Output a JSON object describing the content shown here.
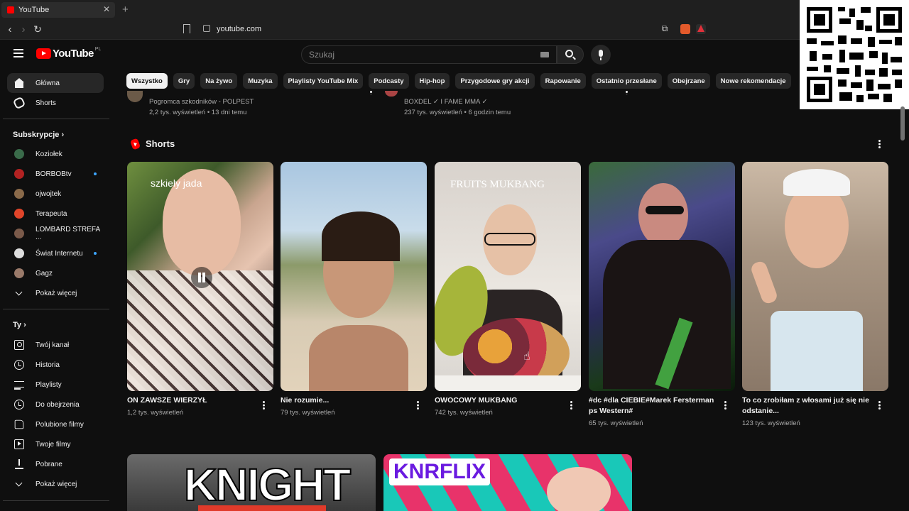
{
  "browser": {
    "tab_title": "YouTube",
    "url": "youtube.com"
  },
  "header": {
    "logo_text": "YouTube",
    "region": "PL",
    "search_placeholder": "Szukaj"
  },
  "sidebar": {
    "main": [
      {
        "label": "Główna",
        "icon": "home-icon",
        "active": true
      },
      {
        "label": "Shorts",
        "icon": "shorts-icon"
      }
    ],
    "subs_title": "Subskrypcje",
    "subs": [
      {
        "label": "Koziołek",
        "color": "#3a6b4a",
        "dot": false
      },
      {
        "label": "BORBOBtv",
        "color": "#b22222",
        "dot": true
      },
      {
        "label": "ojwojtek",
        "color": "#8a6a4a",
        "dot": false
      },
      {
        "label": "Terapeuta",
        "color": "#e0452a",
        "dot": false
      },
      {
        "label": "LOMBARD STREFA ...",
        "color": "#7a5a4a",
        "dot": false
      },
      {
        "label": "Świat Internetu",
        "color": "#dddddd",
        "dot": true
      },
      {
        "label": "Gagz",
        "color": "#9a7a6a",
        "dot": false
      }
    ],
    "subs_more": "Pokaż więcej",
    "you_title": "Ty",
    "you": [
      {
        "label": "Twój kanał",
        "icon": "user-icon"
      },
      {
        "label": "Historia",
        "icon": "history-icon"
      },
      {
        "label": "Playlisty",
        "icon": "playlist-icon"
      },
      {
        "label": "Do obejrzenia",
        "icon": "clock-icon"
      },
      {
        "label": "Polubione filmy",
        "icon": "like-icon"
      },
      {
        "label": "Twoje filmy",
        "icon": "video-icon"
      },
      {
        "label": "Pobrane",
        "icon": "download-icon"
      },
      {
        "label": "Pokaż więcej",
        "icon": "chevron-down-icon"
      }
    ]
  },
  "chips": [
    "Wszystko",
    "Gry",
    "Na żywo",
    "Muzyka",
    "Playlisty YouTube Mix",
    "Podcasty",
    "Hip-hop",
    "Przygodowe gry akcji",
    "Rapowanie",
    "Ostatnio przesłane",
    "Obejrzane",
    "Nowe rekomendacje"
  ],
  "prev_videos": [
    {
      "channel": "Pogromca szkodników - POLPEST",
      "meta": "2,2 tys. wyświetleń • 13 dni temu"
    },
    {
      "channel": "BOXDEL ✓ I FAME MMA ✓",
      "meta": "237 tys. wyświetleń • 6 godzin temu"
    }
  ],
  "shorts": {
    "section_title": "Shorts",
    "items": [
      {
        "title": "ON ZAWSZE WIERZYŁ",
        "views": "1,2 tys. wyświetleń",
        "overlay": "szkiely jada"
      },
      {
        "title": "Nie rozumie...",
        "views": "79 tys. wyświetleń",
        "overlay": ""
      },
      {
        "title": "OWOCOWY MUKBANG",
        "views": "742 tys. wyświetleń",
        "overlay": "FRUITS MUKBANG"
      },
      {
        "title": "#dc #dla CIEBIE#Marek Fersterman ps Western#",
        "views": "65 tys. wyświetleń",
        "overlay": ""
      },
      {
        "title": "To co zrobiłam z włosami już się nie odstanie...",
        "views": "123 tys. wyświetleń",
        "overlay": ""
      }
    ]
  },
  "bottom_thumbs": [
    "KNIGHT",
    "KNRFLIX"
  ]
}
